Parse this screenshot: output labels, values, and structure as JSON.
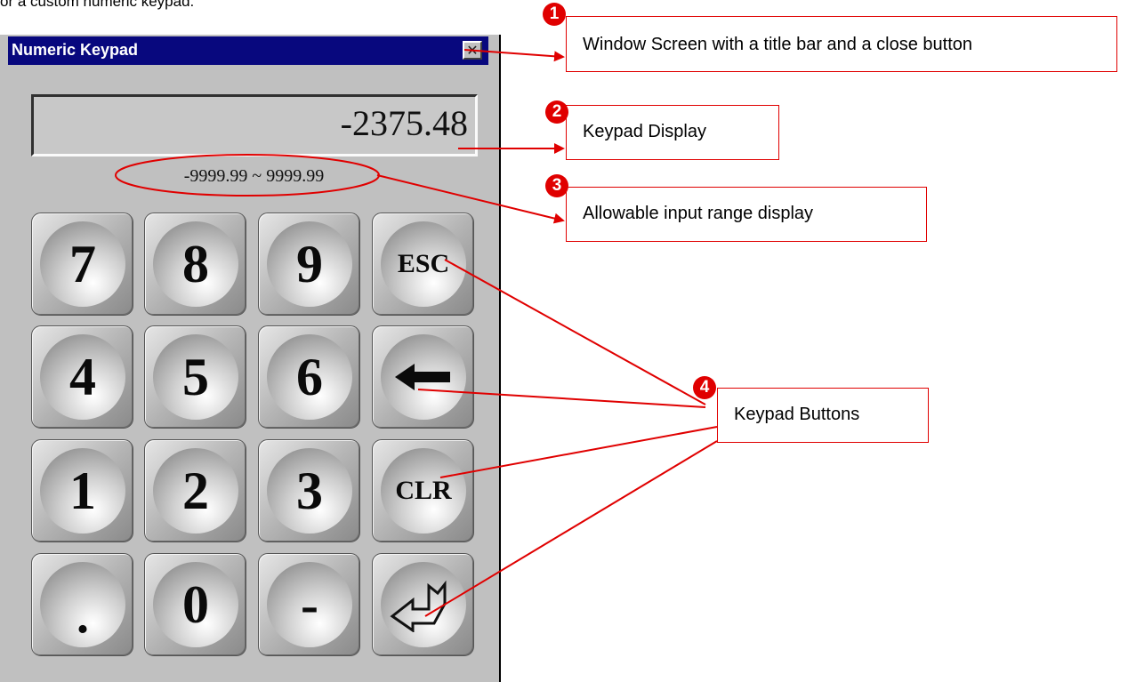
{
  "intro_text": "or a custom numeric keypad.",
  "window": {
    "title": "Numeric Keypad",
    "close_glyph": "✕"
  },
  "display": {
    "value": "-2375.48"
  },
  "range": "-9999.99 ~ 9999.99",
  "keys": [
    {
      "label": "7"
    },
    {
      "label": "8"
    },
    {
      "label": "9"
    },
    {
      "label": "ESC"
    },
    {
      "label": "4"
    },
    {
      "label": "5"
    },
    {
      "label": "6"
    },
    {
      "label": "backspace-arrow-icon"
    },
    {
      "label": "1"
    },
    {
      "label": "2"
    },
    {
      "label": "3"
    },
    {
      "label": "CLR"
    },
    {
      "label": "."
    },
    {
      "label": "0"
    },
    {
      "label": "-"
    },
    {
      "label": "enter-return-icon"
    }
  ],
  "annotations": {
    "accent_color": "#e00000",
    "items": [
      {
        "number": "1",
        "text": "Window Screen with a title bar and a close button"
      },
      {
        "number": "2",
        "text": "Keypad Display"
      },
      {
        "number": "3",
        "text": "Allowable input range display"
      },
      {
        "number": "4",
        "text": "Keypad Buttons"
      }
    ]
  }
}
